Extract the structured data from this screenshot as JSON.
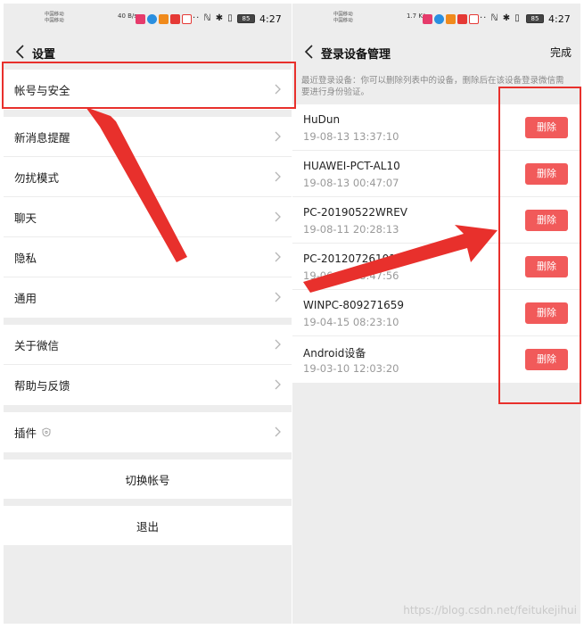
{
  "statusbar": {
    "carrier_1": "中国移动",
    "carrier_2": "中国移动",
    "net_left": "40 B/s",
    "net_right": "1.7 K/s",
    "battery": "85",
    "time": "4:27"
  },
  "settings": {
    "title": "设置",
    "groups": [
      [
        {
          "label": "帐号与安全"
        }
      ],
      [
        {
          "label": "新消息提醒"
        },
        {
          "label": "勿扰模式"
        },
        {
          "label": "聊天"
        },
        {
          "label": "隐私"
        },
        {
          "label": "通用"
        }
      ],
      [
        {
          "label": "关于微信"
        },
        {
          "label": "帮助与反馈"
        }
      ],
      [
        {
          "label": "插件"
        }
      ]
    ],
    "switch_account": "切换帐号",
    "logout": "退出"
  },
  "devices_page": {
    "title": "登录设备管理",
    "done": "完成",
    "notice": "最近登录设备：你可以删除列表中的设备，删除后在该设备登录微信需要进行身份验证。",
    "delete_label": "删除",
    "devices": [
      {
        "name": "HuDun",
        "time": "19-08-13 13:37:10"
      },
      {
        "name": "HUAWEI-PCT-AL10",
        "time": "19-08-13 00:47:07"
      },
      {
        "name": "PC-20190522WREV",
        "time": "19-08-11 20:28:13"
      },
      {
        "name": "PC-201207261016",
        "time": "19-06-18 08:47:56"
      },
      {
        "name": "WINPC-809271659",
        "time": "19-04-15 08:23:10"
      },
      {
        "name": "Android设备",
        "time": "19-03-10 12:03:20"
      }
    ]
  },
  "annotation_color": "#e8302c",
  "watermark": "https://blog.csdn.net/feitukejihui"
}
